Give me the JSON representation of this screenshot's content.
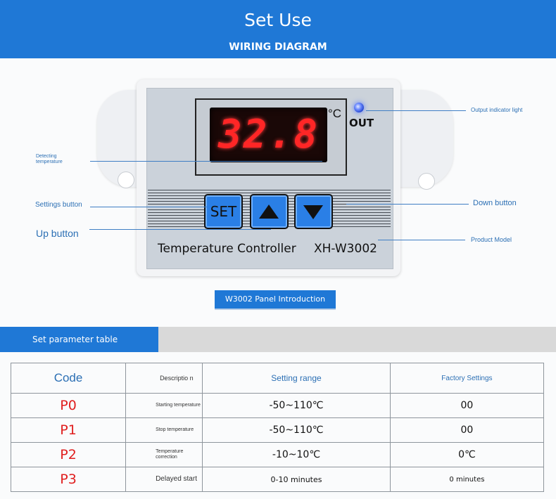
{
  "header": {
    "title": "Set Use",
    "subtitle": "WIRING DIAGRAM"
  },
  "device": {
    "display_value": "32.8",
    "unit": "°C",
    "out_label": "OUT",
    "set_label": "SET",
    "model_name": "Temperature Controller",
    "model_code": "XH-W3002"
  },
  "labels": {
    "output_indicator": "Output indicator light",
    "detecting_temperature": "Detecting temperature",
    "settings_button": "Settings button",
    "up_button": "Up button",
    "down_button": "Down button",
    "product_model": "Product Model"
  },
  "panel_badge": "W3002 Panel Introduction",
  "param_table": {
    "title": "Set parameter table",
    "headers": [
      "Code",
      "Descriptio n",
      "Setting range",
      "Factory Settings"
    ],
    "rows": [
      {
        "code": "P0",
        "description": "Starting temperature",
        "range": "-50~110℃",
        "factory": "00"
      },
      {
        "code": "P1",
        "description": "Stop temperature",
        "range": "-50~110℃",
        "factory": "00"
      },
      {
        "code": "P2",
        "description": "Temperature correction",
        "range": "-10~10℃",
        "factory": "0℃"
      },
      {
        "code": "P3",
        "description": "Delayed start",
        "range": "0-10 minutes",
        "factory": "0 minutes"
      }
    ]
  },
  "colors": {
    "brand_blue": "#1f78d6",
    "label_blue": "#2b6fb4",
    "code_red": "#e01f1f",
    "display_red": "#ff2626"
  }
}
